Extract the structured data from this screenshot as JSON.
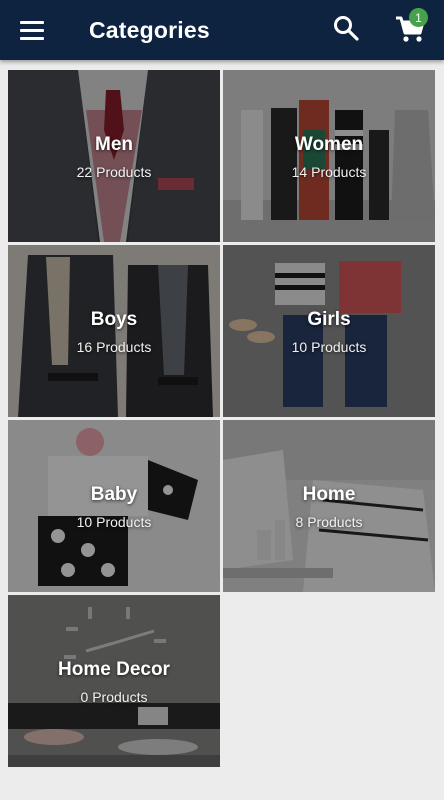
{
  "app_bar": {
    "title": "Categories",
    "menu_icon": "hamburger-menu-icon",
    "search_icon": "search-icon",
    "cart_icon": "shopping-cart-icon",
    "cart_badge": "1",
    "background_color": "#0e2340",
    "badge_color": "#47a14a"
  },
  "categories": [
    {
      "name": "Men",
      "count": "22 Products"
    },
    {
      "name": "Women",
      "count": "14 Products"
    },
    {
      "name": "Boys",
      "count": "16 Products"
    },
    {
      "name": "Girls",
      "count": "10 Products"
    },
    {
      "name": "Baby",
      "count": "10 Products"
    },
    {
      "name": "Home",
      "count": "8 Products"
    },
    {
      "name": "Home Decor",
      "count": "0 Products"
    }
  ]
}
